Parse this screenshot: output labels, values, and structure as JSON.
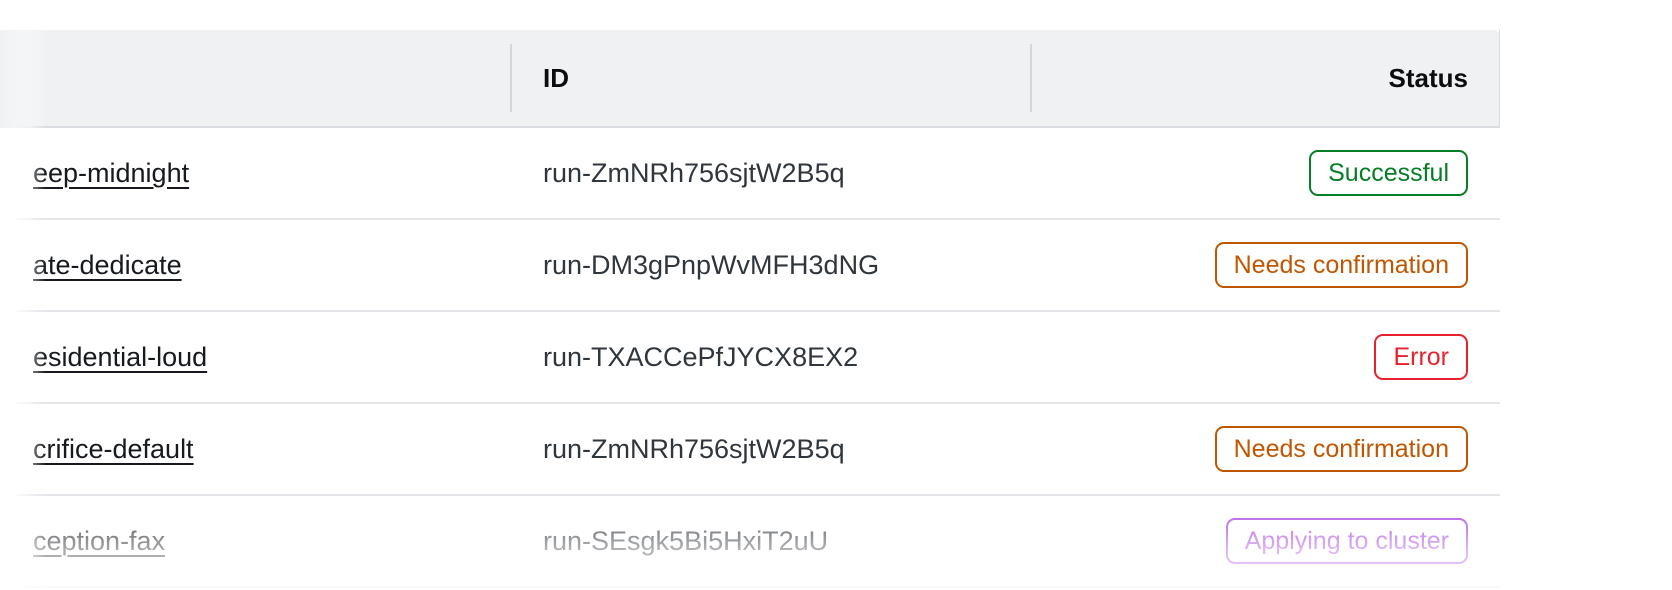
{
  "table": {
    "columns": [
      {
        "id": "name",
        "label": "",
        "align": "left"
      },
      {
        "id": "id",
        "label": "ID",
        "align": "left"
      },
      {
        "id": "status",
        "label": "Status",
        "align": "right"
      }
    ],
    "rows": [
      {
        "name": "eep-midnight",
        "run_id": "run-ZmNRh756sjtW2B5q",
        "status": "Successful",
        "status_kind": "success"
      },
      {
        "name": "ate-dedicate",
        "run_id": "run-DM3gPnpWvMFH3dNG",
        "status": "Needs confirmation",
        "status_kind": "warning"
      },
      {
        "name": "esidential-loud",
        "run_id": "run-TXACCePfJYCX8EX2",
        "status": "Error",
        "status_kind": "error"
      },
      {
        "name": "crifice-default",
        "run_id": "run-ZmNRh756sjtW2B5q",
        "status": "Needs confirmation",
        "status_kind": "warning"
      },
      {
        "name": "ception-fax",
        "run_id": "run-SEsgk5Bi5HxiT2uU",
        "status": "Applying to cluster",
        "status_kind": "progress"
      }
    ]
  },
  "colors": {
    "header_background": "#eff1f3",
    "row_border": "#e3e5e9",
    "header_border": "#d9dce0",
    "text_primary": "#16191d",
    "text_secondary": "#30363d",
    "status_success": "#067d26",
    "status_warning": "#c05600",
    "status_error": "#e8212f",
    "status_progress": "#a63ee0"
  }
}
